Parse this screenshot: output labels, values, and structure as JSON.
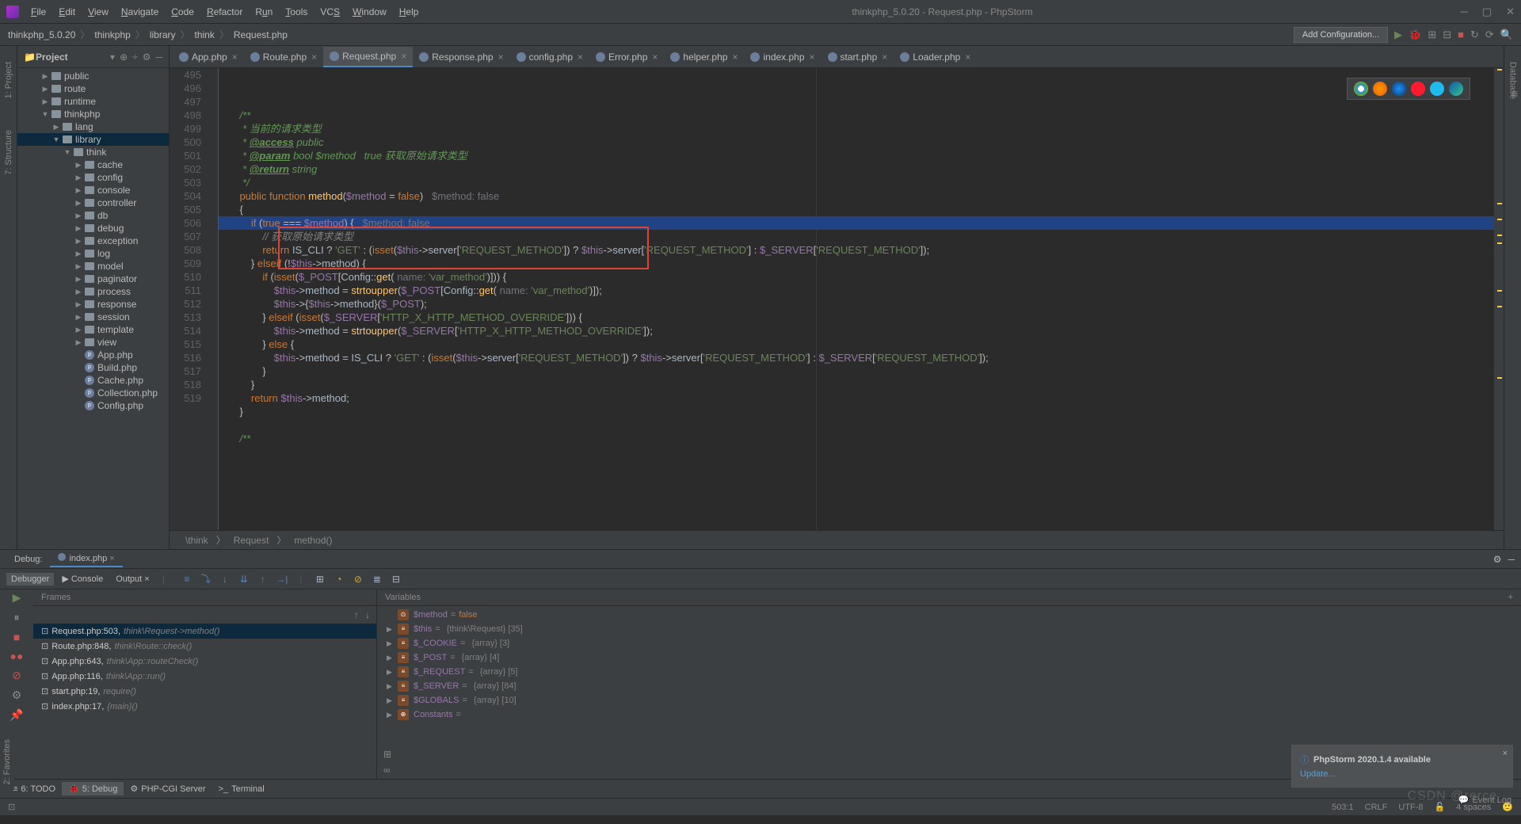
{
  "title": "thinkphp_5.0.20 - Request.php - PhpStorm",
  "menus": [
    "File",
    "Edit",
    "View",
    "Navigate",
    "Code",
    "Refactor",
    "Run",
    "Tools",
    "VCS",
    "Window",
    "Help"
  ],
  "breadcrumb": [
    "thinkphp_5.0.20",
    "thinkphp",
    "library",
    "think",
    "Request.php"
  ],
  "add_config": "Add Configuration...",
  "project": {
    "title": "Project",
    "tree": [
      {
        "d": 2,
        "t": "folder",
        "arr": "▶",
        "label": "public"
      },
      {
        "d": 2,
        "t": "folder",
        "arr": "▶",
        "label": "route"
      },
      {
        "d": 2,
        "t": "folder",
        "arr": "▶",
        "label": "runtime"
      },
      {
        "d": 2,
        "t": "folder",
        "arr": "▼",
        "label": "thinkphp"
      },
      {
        "d": 3,
        "t": "folder",
        "arr": "▶",
        "label": "lang"
      },
      {
        "d": 3,
        "t": "folder",
        "arr": "▼",
        "label": "library",
        "sel": true
      },
      {
        "d": 4,
        "t": "folder",
        "arr": "▼",
        "label": "think"
      },
      {
        "d": 5,
        "t": "folder",
        "arr": "▶",
        "label": "cache"
      },
      {
        "d": 5,
        "t": "folder",
        "arr": "▶",
        "label": "config"
      },
      {
        "d": 5,
        "t": "folder",
        "arr": "▶",
        "label": "console"
      },
      {
        "d": 5,
        "t": "folder",
        "arr": "▶",
        "label": "controller"
      },
      {
        "d": 5,
        "t": "folder",
        "arr": "▶",
        "label": "db"
      },
      {
        "d": 5,
        "t": "folder",
        "arr": "▶",
        "label": "debug"
      },
      {
        "d": 5,
        "t": "folder",
        "arr": "▶",
        "label": "exception"
      },
      {
        "d": 5,
        "t": "folder",
        "arr": "▶",
        "label": "log"
      },
      {
        "d": 5,
        "t": "folder",
        "arr": "▶",
        "label": "model"
      },
      {
        "d": 5,
        "t": "folder",
        "arr": "▶",
        "label": "paginator"
      },
      {
        "d": 5,
        "t": "folder",
        "arr": "▶",
        "label": "process"
      },
      {
        "d": 5,
        "t": "folder",
        "arr": "▶",
        "label": "response"
      },
      {
        "d": 5,
        "t": "folder",
        "arr": "▶",
        "label": "session"
      },
      {
        "d": 5,
        "t": "folder",
        "arr": "▶",
        "label": "template"
      },
      {
        "d": 5,
        "t": "folder",
        "arr": "▶",
        "label": "view"
      },
      {
        "d": 5,
        "t": "php",
        "arr": "",
        "label": "App.php"
      },
      {
        "d": 5,
        "t": "php",
        "arr": "",
        "label": "Build.php"
      },
      {
        "d": 5,
        "t": "php",
        "arr": "",
        "label": "Cache.php"
      },
      {
        "d": 5,
        "t": "php",
        "arr": "",
        "label": "Collection.php"
      },
      {
        "d": 5,
        "t": "php",
        "arr": "",
        "label": "Config.php"
      }
    ]
  },
  "tabs": [
    "App.php",
    "Route.php",
    "Request.php",
    "Response.php",
    "config.php",
    "Error.php",
    "helper.php",
    "index.php",
    "start.php",
    "Loader.php"
  ],
  "active_tab": 2,
  "line_numbers": [
    "495",
    "496",
    "497",
    "498",
    "499",
    "500",
    "501",
    "502",
    "503",
    "504",
    "505",
    "506",
    "507",
    "508",
    "509",
    "510",
    "511",
    "512",
    "513",
    "514",
    "515",
    "516",
    "517",
    "518",
    "519"
  ],
  "crumb_bottom": [
    "\\think",
    "Request",
    "method()"
  ],
  "debug": {
    "label": "Debug:",
    "file": "index.php",
    "tabs": [
      "Debugger",
      "Console",
      "Output"
    ],
    "frames_title": "Frames",
    "vars_title": "Variables",
    "frames": [
      {
        "loc": "Request.php:503,",
        "cls": "think\\Request->method()",
        "sel": true
      },
      {
        "loc": "Route.php:848,",
        "cls": "think\\Route::check()"
      },
      {
        "loc": "App.php:643,",
        "cls": "think\\App::routeCheck()"
      },
      {
        "loc": "App.php:116,",
        "cls": "think\\App::run()"
      },
      {
        "loc": "start.php:19,",
        "cls": "require()"
      },
      {
        "loc": "index.php:17,",
        "cls": "{main}()"
      }
    ],
    "vars": [
      {
        "arr": "",
        "ico": "⊙",
        "name": "$method",
        "val": "false",
        "type": ""
      },
      {
        "arr": "▶",
        "ico": "≡",
        "name": "$this",
        "val": "",
        "type": "{think\\Request} [35]"
      },
      {
        "arr": "▶",
        "ico": "≡",
        "name": "$_COOKIE",
        "val": "",
        "type": "{array} [3]"
      },
      {
        "arr": "▶",
        "ico": "≡",
        "name": "$_POST",
        "val": "",
        "type": "{array} [4]"
      },
      {
        "arr": "▶",
        "ico": "≡",
        "name": "$_REQUEST",
        "val": "",
        "type": "{array} [5]"
      },
      {
        "arr": "▶",
        "ico": "≡",
        "name": "$_SERVER",
        "val": "",
        "type": "{array} [84]"
      },
      {
        "arr": "▶",
        "ico": "≡",
        "name": "$GLOBALS",
        "val": "",
        "type": "{array} [10]"
      },
      {
        "arr": "▶",
        "ico": "⊕",
        "name": "Constants",
        "val": "",
        "type": ""
      }
    ]
  },
  "bottom_tabs": [
    {
      "ico": "≡",
      "label": "6: TODO"
    },
    {
      "ico": "🐞",
      "label": "5: Debug",
      "active": true
    },
    {
      "ico": "⚙",
      "label": "PHP-CGI Server"
    },
    {
      "ico": ">_",
      "label": "Terminal"
    }
  ],
  "status": {
    "pos": "503:1",
    "crlf": "CRLF",
    "enc": "UTF-8",
    "spaces": "4 spaces"
  },
  "notif": {
    "title": "PhpStorm 2020.1.4 available",
    "link": "Update..."
  },
  "eventlog": "Event Log",
  "sidetabs_left": [
    "1: Project",
    "7: Structure"
  ],
  "sidetab_right": "Database",
  "fav": "2: Favorites",
  "watermark": "CSDN @rerce"
}
